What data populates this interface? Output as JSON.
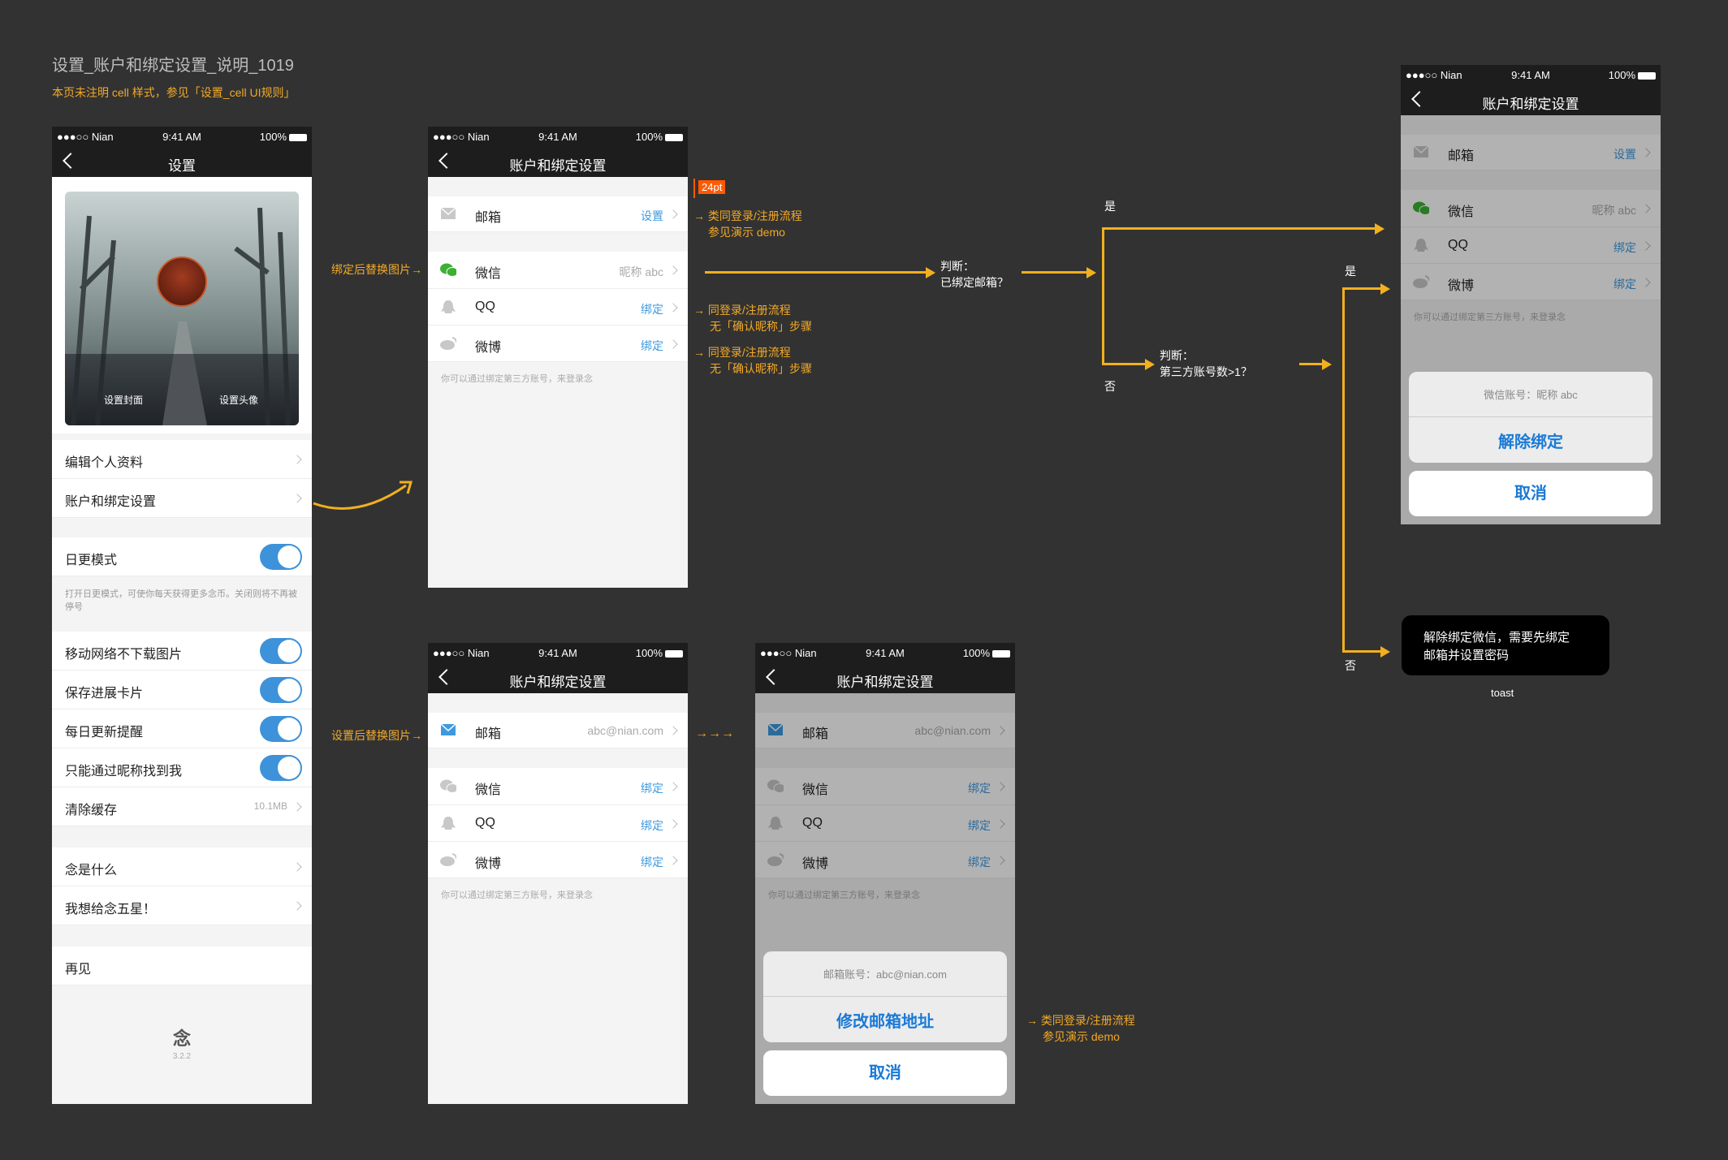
{
  "board": {
    "title": "设置_账户和绑定设置_说明_1019",
    "subtitle": "本页未注明 cell 样式，参见「设置_cell UI规则」"
  },
  "status_bar": {
    "carrier": "●●●○○ Nian",
    "time": "9:41 AM",
    "battery": "100%"
  },
  "settings": {
    "title": "设置",
    "cover_label": "设置封面",
    "avatar_label": "设置头像",
    "items": [
      "编辑个人资料",
      "账户和绑定设置",
      "日更模式",
      "移动网络不下载图片",
      "保存进展卡片",
      "每日更新提醒",
      "只能通过昵称找到我",
      "清除缓存",
      "念是什么",
      "我想给念五星！",
      "再见"
    ],
    "daily_desc": "打开日更模式，可使你每天获得更多念币。关闭则将不再被停号",
    "cache_size": "10.1MB",
    "logo": "念",
    "version": "3.2.2"
  },
  "account": {
    "title": "账户和绑定设置",
    "email": "邮箱",
    "wechat": "微信",
    "qq": "QQ",
    "weibo": "微博",
    "set": "设置",
    "bind": "绑定",
    "nickname": "昵称 abc",
    "email_value": "abc@nian.com",
    "hint": "你可以通过绑定第三方账号，来登录念"
  },
  "sheets": {
    "wechat_account": "微信账号：昵称 abc",
    "unbind": "解除绑定",
    "cancel": "取消",
    "email_account": "邮箱账号：abc@nian.com",
    "change_email": "修改邮箱地址"
  },
  "annotations": {
    "spacing": "24pt",
    "bind_replace": "绑定后替换图片→",
    "set_replace": "设置后替换图片→",
    "email_flow_1": "→ 类同登录/注册流程",
    "email_flow_2": "参见演示 demo",
    "qq_flow_1": "→ 同登录/注册流程",
    "qq_flow_2": "无「确认昵称」步骤",
    "weibo_flow_1": "→ 同登录/注册流程",
    "weibo_flow_2": "无「确认昵称」步骤",
    "arrows": "→→→",
    "judge1_a": "判断：",
    "judge1_b": "已绑定邮箱？",
    "judge2_a": "判断：",
    "judge2_b": "第三方账号数>1？",
    "yes": "是",
    "no": "否",
    "toast_text_1": "解除绑定微信，需要先绑定",
    "toast_text_2": "邮箱并设置密码",
    "toast_label": "toast",
    "change_flow_1": "→ 类同登录/注册流程",
    "change_flow_2": "参见演示 demo"
  },
  "colors": {
    "accent": "#f2b01e",
    "link": "#3e9ae0",
    "toggle": "#3e92d9",
    "dark": "#1d1d1d"
  }
}
